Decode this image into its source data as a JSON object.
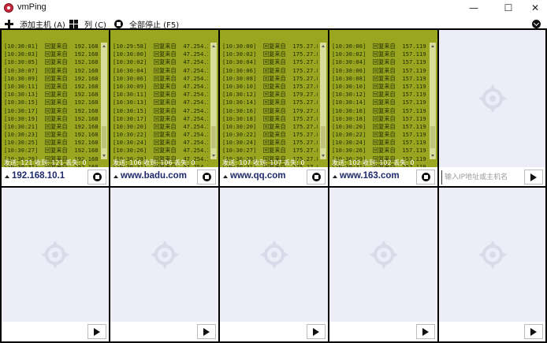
{
  "window": {
    "title": "vmPing",
    "minimize_glyph": "—",
    "maximize_glyph": "☐",
    "close_glyph": "✕"
  },
  "toolbar": {
    "add_host_label": "添加主机 (A)",
    "columns_label": "列 (C)",
    "stop_all_label": "全部停止 (F5)"
  },
  "monitors": [
    {
      "host": "192.168.10.1",
      "stats": "发送: 121  收到: 121  丢失: 0",
      "lines": [
        "[10:30:01]  回复来自  192.168.10.1",
        "[10:30:03]  回复来自  192.168.10.1",
        "[10:30:05]  回复来自  192.168.10.1",
        "[10:30:07]  回复来自  192.168.10.1",
        "[10:30:09]  回复来自  192.168.10.1",
        "[10:30:11]  回复来自  192.168.10.1",
        "[10:30:13]  回复来自  192.168.10.1",
        "[10:30:15]  回复来自  192.168.10.1",
        "[10:30:17]  回复来自  192.168.10.1",
        "[10:30:19]  回复来自  192.168.10.1",
        "[10:30:21]  回复来自  192.168.10.1",
        "[10:30:23]  回复来自  192.168.10.1",
        "[10:30:25]  回复来自  192.168.10.1",
        "[10:30:27]  回复来自  192.168.10.1",
        "[10:30:29]  回复来自  192.168.10.1",
        "[10:30:31]  回复来自  192.168.10.1"
      ]
    },
    {
      "host": "www.badu.com",
      "stats": "发送: 106  收到: 106  丢失: 0",
      "lines": [
        "[10:29:58]  回复来自  47.254.33.",
        "[10:30:00]  回复来自  47.254.33.",
        "[10:30:02]  回复来自  47.254.33.",
        "[10:30:04]  回复来自  47.254.33.",
        "[10:30:06]  回复来自  47.254.33.",
        "[10:30:09]  回复来自  47.254.33.",
        "[10:30:11]  回复来自  47.254.33.",
        "[10:30:13]  回复来自  47.254.33.",
        "[10:30:15]  回复来自  47.254.33.",
        "[10:30:17]  回复来自  47.254.33.",
        "[10:30:20]  回复来自  47.254.33.",
        "[10:30:22]  回复来自  47.254.33.",
        "[10:30:24]  回复来自  47.254.33.",
        "[10:30:26]  回复来自  47.254.33.",
        "[10:30:28]  回复来自  47.254.33.",
        "[10:30:31]  回复来自  47.254.33."
      ]
    },
    {
      "host": "www.qq.com",
      "stats": "发送: 107  收到: 107  丢失: 0",
      "lines": [
        "[10:30:00]  回复来自  175.27.8.1",
        "[10:30:02]  回复来自  175.27.8.1",
        "[10:30:04]  回复来自  175.27.8.1",
        "[10:30:06]  回复来自  175.27.8.1",
        "[10:30:08]  回复来自  175.27.8.1",
        "[10:30:10]  回复来自  175.27.8.1",
        "[10:30:12]  回复来自  179.27.8.1",
        "[10:30:14]  回复来自  175.27.8.1",
        "[10:30:16]  回复来自  179.27.8.1",
        "[10:30:18]  回复来自  175.27.8.1",
        "[10:30:20]  回复来自  175.27.8.1",
        "[10:30:22]  回复来自  175.27.8.1",
        "[10:30:24]  回复来自  175.27.8.1",
        "[10:30:27]  回复来自  175.27.8.1",
        "[10:30:29]  回复来自  175.27.8.1",
        "[10:30:31]  回复来自  175.27.8.1"
      ]
    },
    {
      "host": "www.163.com",
      "stats": "发送: 102  收到: 102  丢失: 0",
      "lines": [
        "[10:30:00]  回复来自  157.119.17",
        "[10:30:02]  回复来自  157.119.17",
        "[10:30:04]  回复来自  157.119.17",
        "[10:30:06]  回复来自  157.119.17",
        "[10:30:08]  回复来自  157.119.17",
        "[10:30:10]  回复来自  157.119.17",
        "[10:30:12]  回复来自  157.119.17",
        "[10:30:14]  回复来自  157.119.17",
        "[10:30:16]  回复来自  157.119.17",
        "[10:30:18]  回复来自  157.119.17",
        "[10:30:20]  回复来自  157.119.17",
        "[10:30:22]  回复来自  157.119.17",
        "[10:30:24]  回复来自  157.119.17",
        "[10:30:26]  回复来自  157.119.17",
        "[10:30:29]  回复来自  157.119.17",
        "[10:30:31]  回复来自  157.119.17"
      ]
    }
  ],
  "empty_slot": {
    "input_placeholder": "输入IP地址或主机名"
  },
  "colors": {
    "console_bg": "#9aa520",
    "host_text": "#1e2a6b",
    "empty_bg": "#ededf8"
  }
}
